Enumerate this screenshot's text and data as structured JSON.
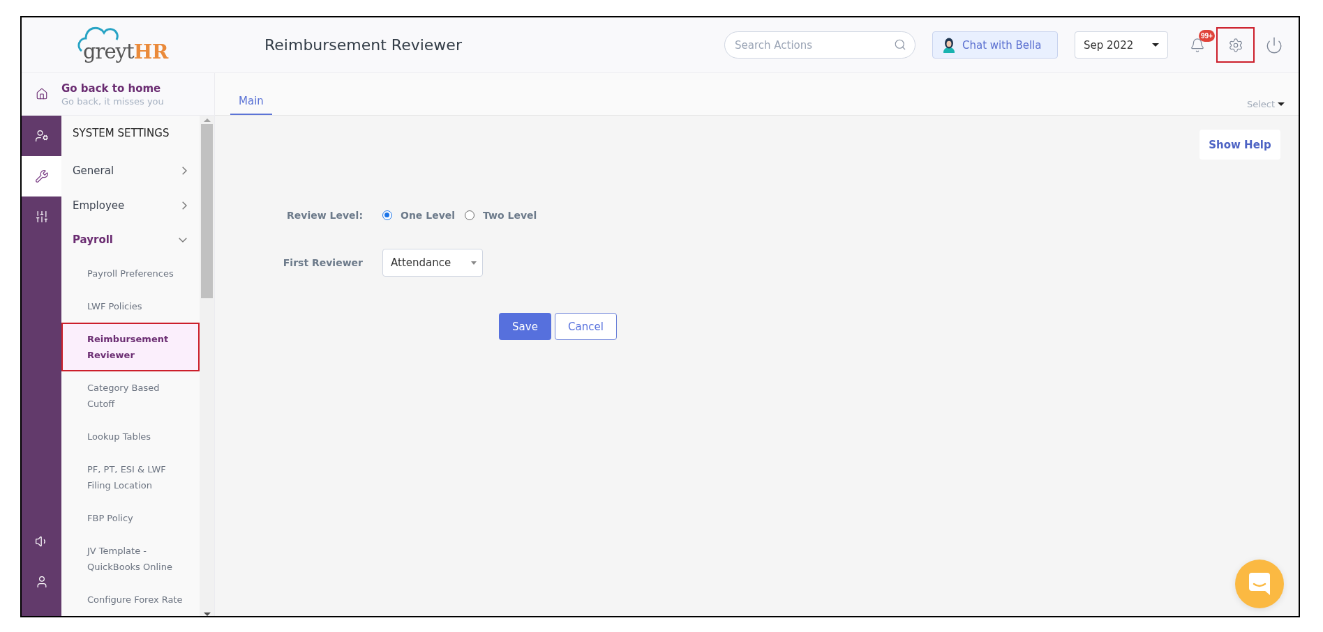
{
  "header": {
    "logo": {
      "first": "greyt",
      "second": "HR"
    },
    "title": "Reimbursement Reviewer",
    "search": {
      "placeholder": "Search Actions"
    },
    "chat_button": "Chat with Bella",
    "period": "Sep 2022",
    "notification_badge": "99+",
    "settings_highlighted": true
  },
  "rail": {
    "top": [
      {
        "kind": "user-settings",
        "selected": false
      },
      {
        "kind": "wrench",
        "selected": true
      },
      {
        "kind": "sliders",
        "selected": false
      }
    ],
    "bottom": [
      {
        "kind": "speaker",
        "selected": false
      },
      {
        "kind": "user",
        "selected": false
      }
    ]
  },
  "home_link": {
    "title": "Go back to home",
    "subtitle": "Go back, it misses you"
  },
  "sidebar": {
    "heading": "SYSTEM SETTINGS",
    "items": [
      {
        "label": "General",
        "expanded": false
      },
      {
        "label": "Employee",
        "expanded": false
      },
      {
        "label": "Payroll",
        "expanded": true,
        "children": [
          {
            "label": "Payroll Preferences",
            "selected": false
          },
          {
            "label": "LWF Policies",
            "selected": false
          },
          {
            "label": "Reimbursement Reviewer",
            "selected": true
          },
          {
            "label": "Category Based Cutoff",
            "selected": false
          },
          {
            "label": "Lookup Tables",
            "selected": false
          },
          {
            "label": "PF, PT, ESI & LWF Filing Location",
            "selected": false
          },
          {
            "label": "FBP Policy",
            "selected": false
          },
          {
            "label": "JV Template - QuickBooks Online",
            "selected": false
          },
          {
            "label": "Configure Forex Rate",
            "selected": false
          }
        ]
      }
    ]
  },
  "tabs": [
    {
      "label": "Main",
      "selected": true
    }
  ],
  "select_menu": "Select",
  "show_help": "Show Help",
  "form": {
    "review_level_label": "Review Level:",
    "review_options": [
      {
        "label": "One Level",
        "selected": true
      },
      {
        "label": "Two Level",
        "selected": false
      }
    ],
    "first_reviewer_label": "First Reviewer",
    "first_reviewer_value": "Attendance"
  },
  "buttons": {
    "save": "Save",
    "cancel": "Cancel"
  }
}
